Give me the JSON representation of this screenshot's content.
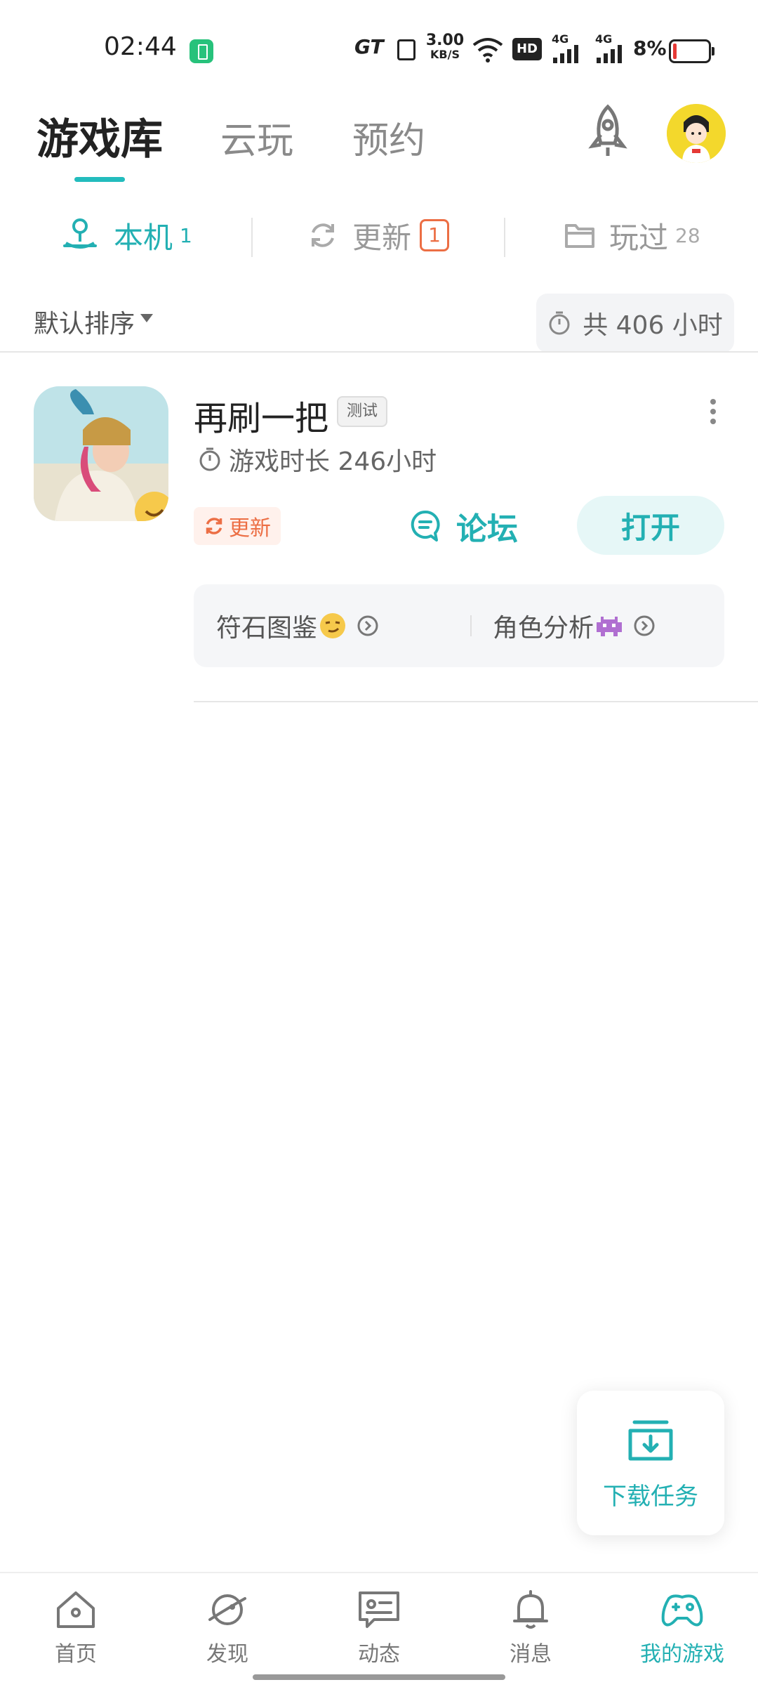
{
  "status_bar": {
    "time": "02:44",
    "network_speed": "3.00",
    "network_unit": "KB/S",
    "battery_percent": "8%",
    "gt_label": "GT",
    "hd_label": "HD",
    "signal_label_1": "4G",
    "signal_label_2": "4G"
  },
  "top_tabs": [
    {
      "label": "游戏库"
    },
    {
      "label": "云玩"
    },
    {
      "label": "预约"
    }
  ],
  "sub_tabs": {
    "local": {
      "label": "本机",
      "count": "1"
    },
    "update": {
      "label": "更新",
      "count": "1"
    },
    "played": {
      "label": "玩过",
      "count": "28"
    }
  },
  "sort": {
    "label": "默认排序"
  },
  "total_time": {
    "label": "共 406 小时"
  },
  "game": {
    "title": "再刷一把",
    "tag": "测试",
    "play_time": "游戏时长 246小时",
    "update_label": "更新",
    "forum_label": "论坛",
    "open_label": "打开",
    "guides": [
      {
        "label": "符石图鉴"
      },
      {
        "label": "角色分析"
      }
    ]
  },
  "download_task": {
    "label": "下载任务"
  },
  "bottom_nav": [
    {
      "label": "首页"
    },
    {
      "label": "发现"
    },
    {
      "label": "动态"
    },
    {
      "label": "消息"
    },
    {
      "label": "我的游戏"
    }
  ],
  "colors": {
    "accent": "#23b0b3",
    "update": "#ec6e44"
  },
  "icons": [
    "rocket-icon",
    "avatar",
    "joystick-icon",
    "refresh-icon",
    "folder-icon",
    "timer-icon",
    "forum-icon",
    "download-icon",
    "home-icon",
    "planet-icon",
    "message-icon",
    "bell-icon",
    "gamepad-icon"
  ]
}
